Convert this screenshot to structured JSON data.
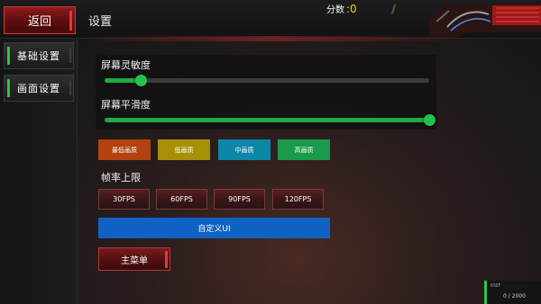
{
  "header": {
    "back_label": "返回",
    "title": "设置",
    "score_label": "分数",
    "score_value": ":0"
  },
  "sidebar": {
    "items": [
      {
        "label": "基础设置"
      },
      {
        "label": "画面设置"
      }
    ]
  },
  "sliders": [
    {
      "label": "屏幕灵敏度",
      "value": 0.11
    },
    {
      "label": "屏幕平滑度",
      "value": 1.0
    }
  ],
  "quality": {
    "buttons": [
      {
        "label": "最低画质",
        "color": "#b2420f"
      },
      {
        "label": "低画质",
        "color": "#a88f08"
      },
      {
        "label": "中画质",
        "color": "#0e86a8"
      },
      {
        "label": "高画质",
        "color": "#1a9a4a"
      }
    ]
  },
  "fps": {
    "label": "帧率上限",
    "buttons": [
      {
        "label": "30FPS"
      },
      {
        "label": "60FPS"
      },
      {
        "label": "90FPS"
      },
      {
        "label": "120FPS"
      }
    ]
  },
  "custom_ui_label": "自定义UI",
  "main_menu_label": "主菜单",
  "weapon": {
    "name": "KNIF",
    "count": "0 / 2000"
  },
  "colors": {
    "accent_green": "#29c74a",
    "accent_red": "#e23838",
    "score_yellow": "#f5d800",
    "custom_blue": "#0e62c4"
  }
}
